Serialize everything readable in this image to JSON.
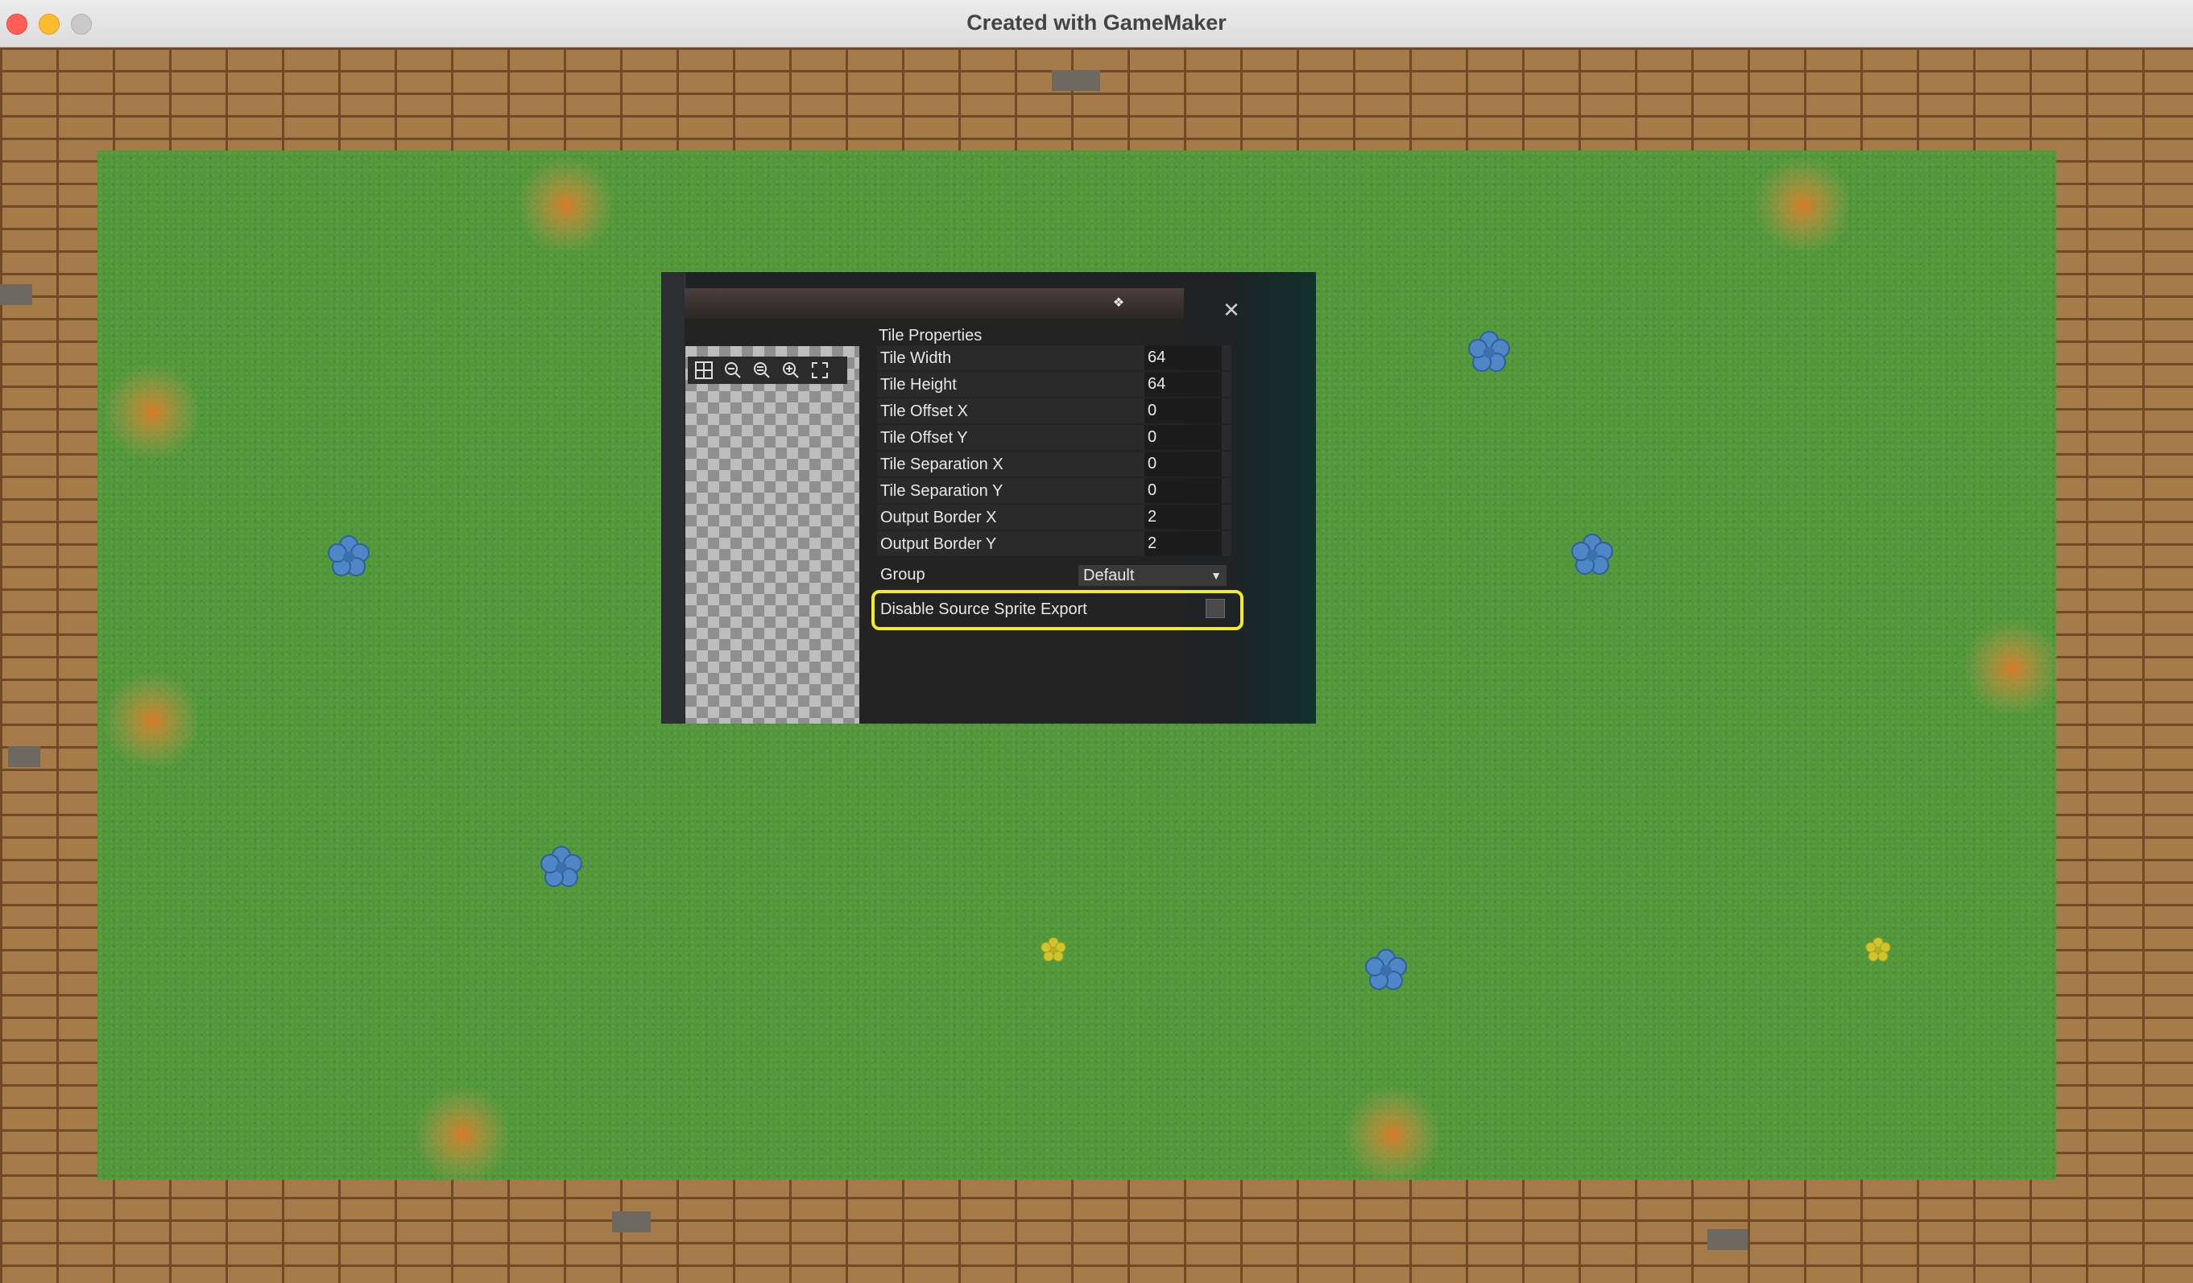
{
  "window": {
    "title": "Created with GameMaker",
    "buttons": [
      "close-icon",
      "minimize-icon",
      "zoom-icon"
    ]
  },
  "game": {
    "grass_color": "#52983a",
    "wall_color": "#a57b4a"
  },
  "dialog": {
    "section_title": "Tile Properties",
    "close_symbol": "✕",
    "properties": [
      {
        "label": "Tile Width",
        "value": "64"
      },
      {
        "label": "Tile Height",
        "value": "64"
      },
      {
        "label": "Tile Offset X",
        "value": "0"
      },
      {
        "label": "Tile Offset Y",
        "value": "0"
      },
      {
        "label": "Tile Separation X",
        "value": "0"
      },
      {
        "label": "Tile Separation Y",
        "value": "0"
      },
      {
        "label": "Output Border X",
        "value": "2"
      },
      {
        "label": "Output Border Y",
        "value": "2"
      }
    ],
    "group": {
      "label": "Group",
      "value": "Default"
    },
    "disable_export": {
      "label": "Disable Source Sprite Export",
      "checked": false
    },
    "highlight_color": "#f4ea2a"
  }
}
